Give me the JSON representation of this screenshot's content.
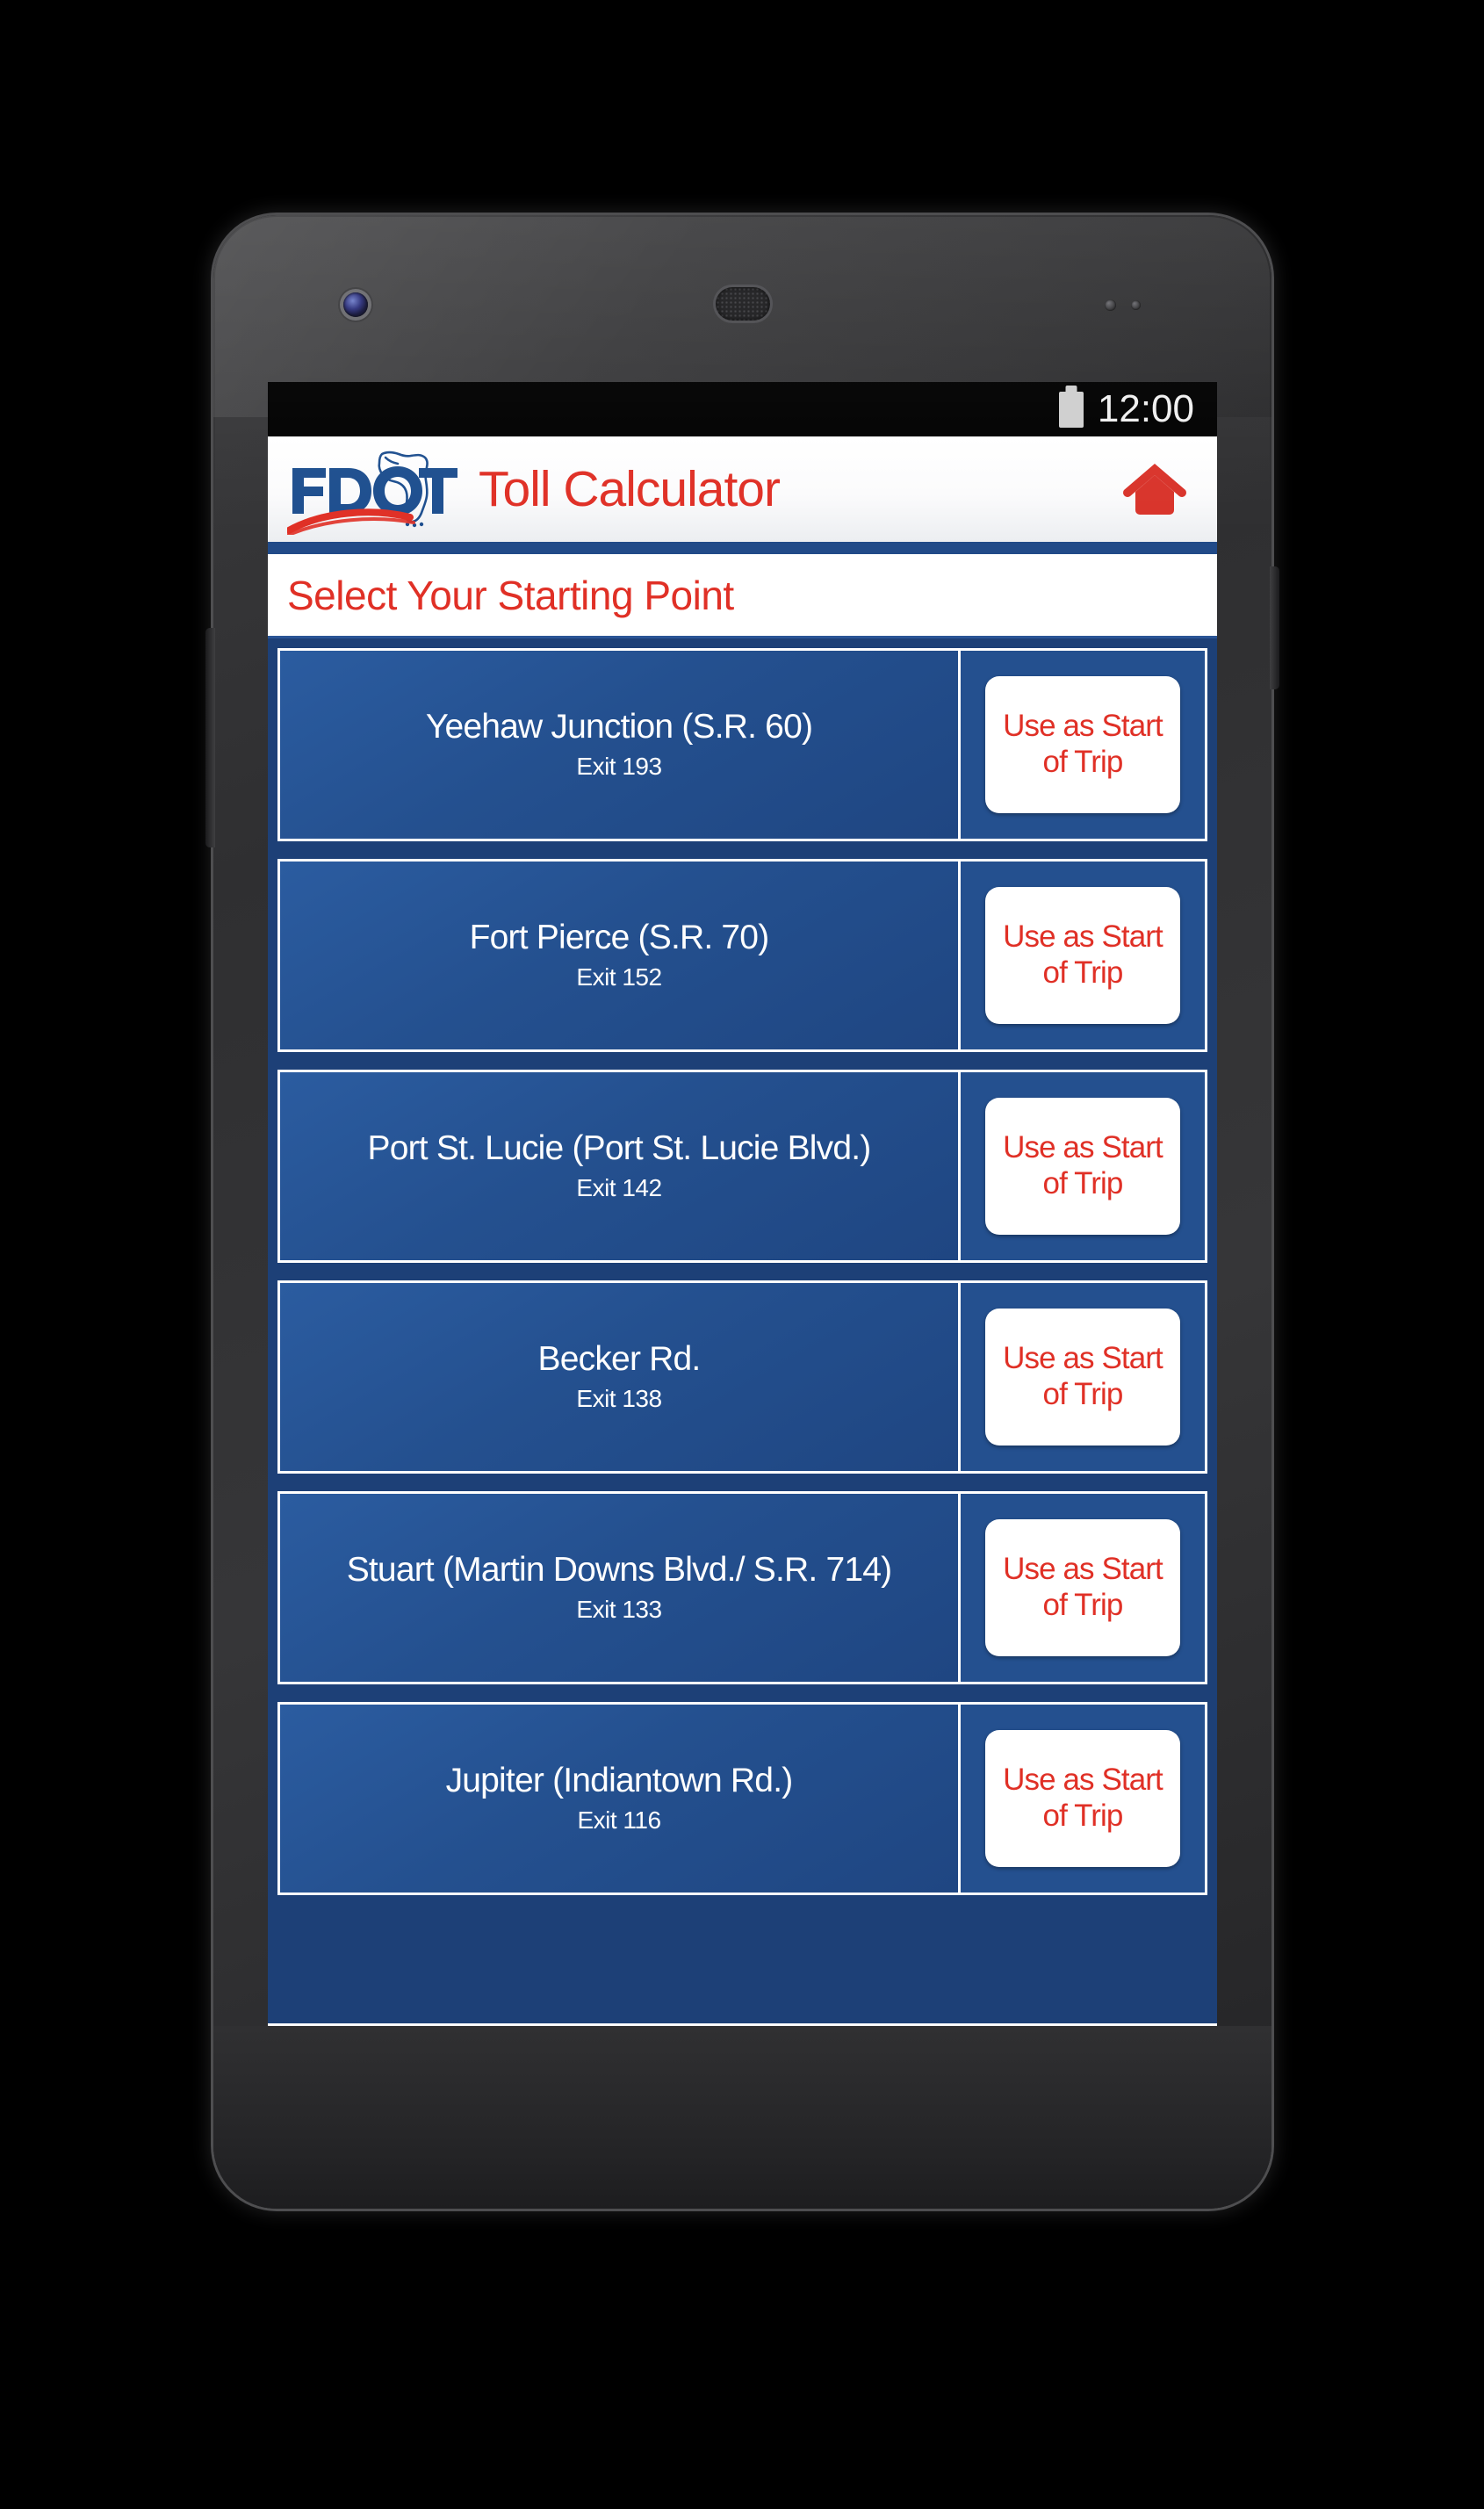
{
  "status_bar": {
    "time": "12:00",
    "battery_icon": "battery-icon"
  },
  "app_header": {
    "logo_text": "FDOT",
    "logo_name": "fdot-logo",
    "title": "Toll Calculator",
    "home_icon": "home-icon",
    "title_color": "#e03026",
    "logo_blue": "#1e4f8f",
    "logo_red": "#e03026"
  },
  "section": {
    "title": "Select Your Starting Point",
    "title_color": "#e03026"
  },
  "theme": {
    "list_background": "#1d4077",
    "row_background": "#24508f",
    "row_border": "#ffffff",
    "cta_background": "#ffffff",
    "cta_text_color": "#e03026"
  },
  "list": {
    "cta_label": "Use as Start of Trip",
    "items": [
      {
        "name": "Yeehaw Junction (S.R. 60)",
        "exit": "Exit 193",
        "cta": "Use as Start of Trip"
      },
      {
        "name": "Fort Pierce (S.R. 70)",
        "exit": "Exit 152",
        "cta": "Use as Start of Trip"
      },
      {
        "name": "Port St. Lucie (Port St. Lucie Blvd.)",
        "exit": "Exit 142",
        "cta": "Use as Start of Trip"
      },
      {
        "name": "Becker Rd.",
        "exit": "Exit 138",
        "cta": "Use as Start of Trip"
      },
      {
        "name": "Stuart (Martin Downs Blvd./ S.R. 714)",
        "exit": "Exit 133",
        "cta": "Use as Start of Trip"
      },
      {
        "name": "Jupiter (Indiantown Rd.)",
        "exit": "Exit 116",
        "cta": "Use as Start of Trip"
      }
    ]
  },
  "device": {
    "camera_icon": "front-camera",
    "speaker_icon": "earpiece-speaker",
    "sensor_icon": "proximity-sensor",
    "volume_button": "volume-rocker",
    "power_button": "power-button"
  }
}
